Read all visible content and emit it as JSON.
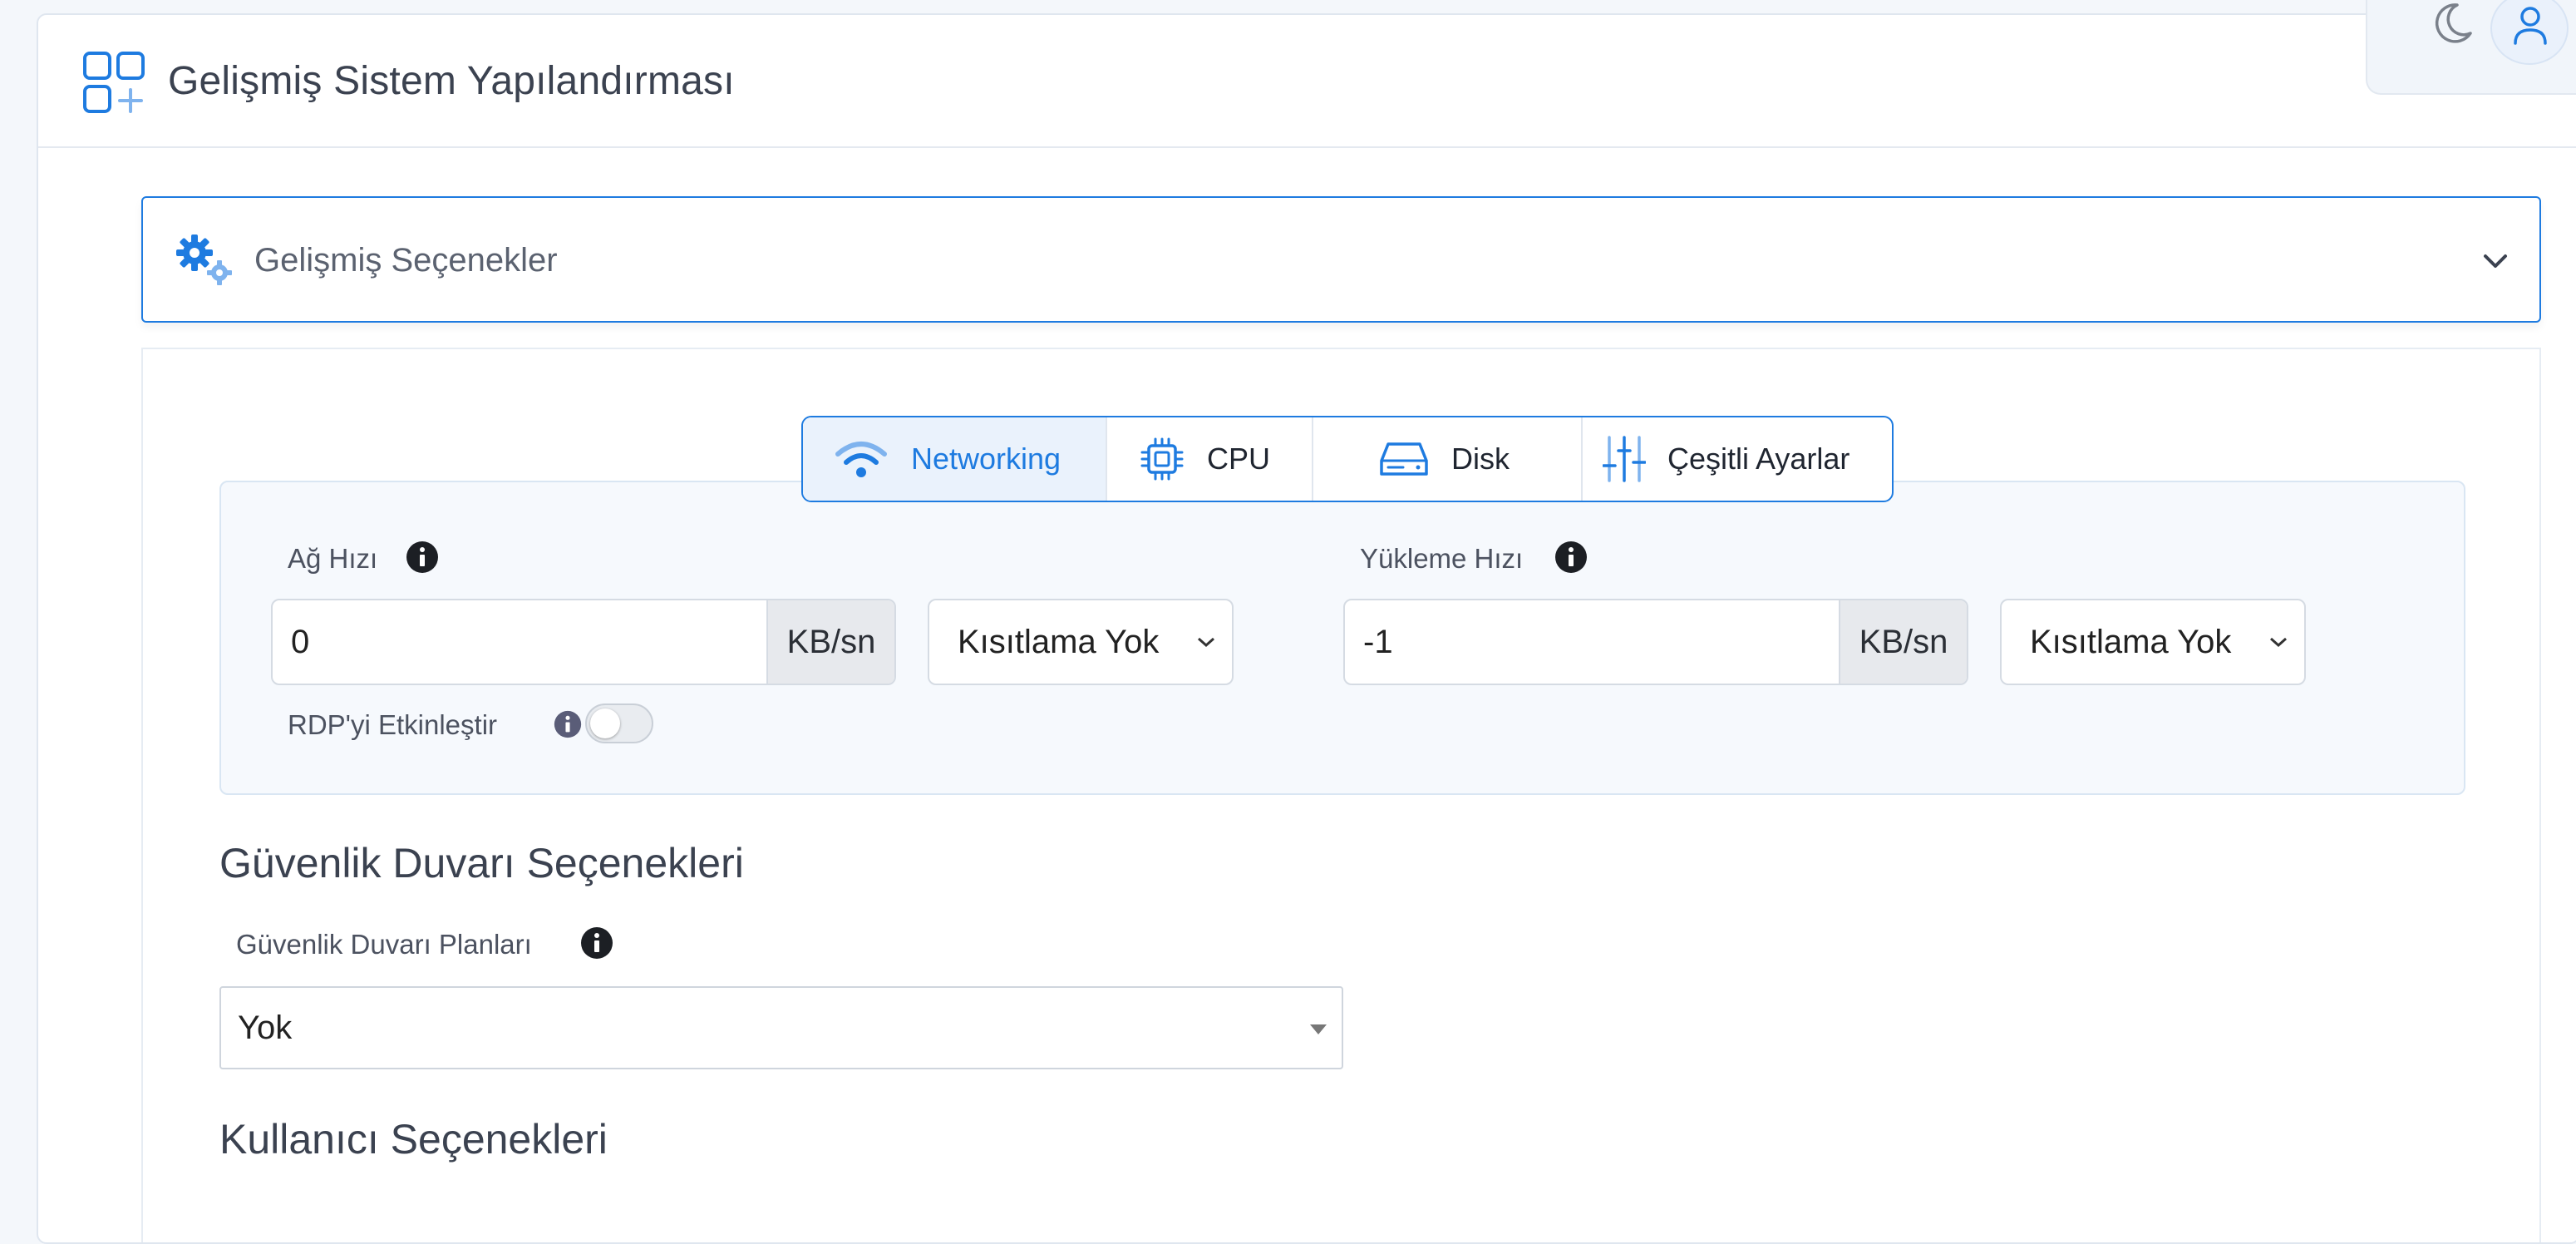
{
  "header": {
    "title": "Gelişmiş Sistem Yapılandırması",
    "icon": "apps-add-icon",
    "theme_icon": "moon-icon",
    "user_icon": "user-icon"
  },
  "accordion": {
    "title": "Gelişmiş Seçenekler",
    "icon": "gears-icon",
    "expanded": true
  },
  "tabs": [
    {
      "label": "Networking",
      "icon": "wifi-icon",
      "active": true
    },
    {
      "label": "CPU",
      "icon": "cpu-icon",
      "active": false
    },
    {
      "label": "Disk",
      "icon": "hard-drive-icon",
      "active": false
    },
    {
      "label": "Çeşitli Ayarlar",
      "icon": "sliders-icon",
      "active": false
    }
  ],
  "networking": {
    "network_speed": {
      "label": "Ağ Hızı",
      "value": "0",
      "unit": "KB/sn",
      "limit": "Kısıtlama Yok"
    },
    "upload_speed": {
      "label": "Yükleme Hızı",
      "value": "-1",
      "unit": "KB/sn",
      "limit": "Kısıtlama Yok"
    },
    "rdp": {
      "label": "RDP'yi Etkinleştir",
      "enabled": false
    }
  },
  "firewall": {
    "section_title": "Güvenlik Duvarı Seçenekleri",
    "plans_label": "Güvenlik Duvarı Planları",
    "plans_value": "Yok"
  },
  "user_options": {
    "section_title": "Kullanıcı Seçenekleri"
  },
  "colors": {
    "accent": "#1e7be0",
    "accent_light": "#6aa8ee",
    "panel_bg": "#f6f9fd",
    "addon_bg": "#e7e9ed"
  }
}
